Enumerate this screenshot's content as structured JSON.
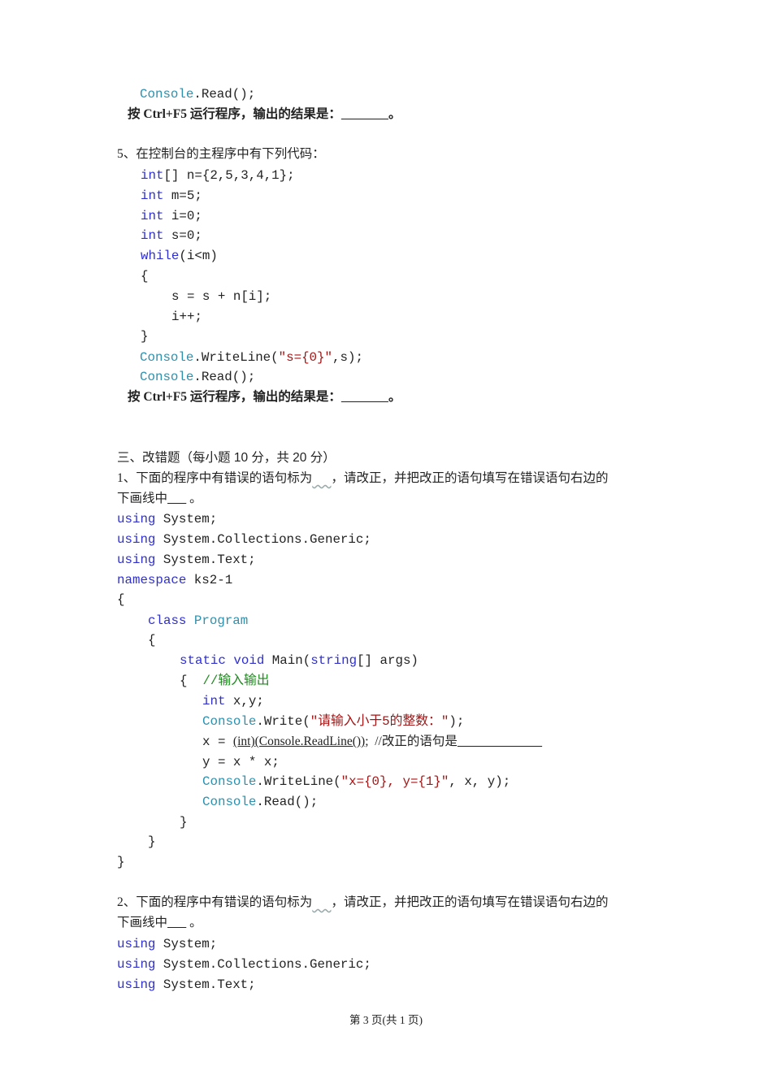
{
  "colors": {
    "keyword": "#2f2fd0",
    "type": "#2b91af",
    "string": "#a31515",
    "comment": "#1f8a1f"
  },
  "lines": [
    {
      "kind": "code",
      "segs": [
        [
          "Console",
          "type"
        ],
        [
          ".Read();",
          "plain"
        ]
      ]
    },
    {
      "kind": "bold",
      "segs": [
        [
          "按 Ctrl+F5 运行程序，输出的结果是：",
          "plain"
        ],
        [
          "               ",
          "blank"
        ],
        [
          "。",
          "plain"
        ]
      ]
    },
    {
      "kind": "text",
      "segs": [
        [
          "5、在控制台的主程序中有下列代码：",
          "plain"
        ]
      ]
    },
    {
      "kind": "code",
      "segs": [
        [
          "int",
          "kw"
        ],
        [
          "[] n={2,5,3,4,1};",
          "plain"
        ]
      ]
    },
    {
      "kind": "code",
      "segs": [
        [
          "int",
          "kw"
        ],
        [
          " m=5;",
          "plain"
        ]
      ]
    },
    {
      "kind": "code",
      "segs": [
        [
          "int",
          "kw"
        ],
        [
          " i=0;",
          "plain"
        ]
      ]
    },
    {
      "kind": "code",
      "segs": [
        [
          "int",
          "kw"
        ],
        [
          " s=0;",
          "plain"
        ]
      ]
    },
    {
      "kind": "code",
      "segs": [
        [
          "while",
          "kw"
        ],
        [
          "(i<m)",
          "plain"
        ]
      ]
    },
    {
      "kind": "code",
      "segs": [
        [
          "{",
          "plain"
        ]
      ]
    },
    {
      "kind": "code",
      "segs": [
        [
          "s = s + n[i];",
          "plain"
        ]
      ]
    },
    {
      "kind": "code",
      "segs": [
        [
          "i++;",
          "plain"
        ]
      ]
    },
    {
      "kind": "code",
      "segs": [
        [
          "}",
          "plain"
        ]
      ]
    },
    {
      "kind": "code",
      "segs": [
        [
          "Console",
          "type"
        ],
        [
          ".WriteLine(",
          "plain"
        ],
        [
          "\"s={0}\"",
          "str"
        ],
        [
          ",s);",
          "plain"
        ]
      ]
    },
    {
      "kind": "code",
      "segs": [
        [
          "Console",
          "type"
        ],
        [
          ".Read();",
          "plain"
        ]
      ]
    },
    {
      "kind": "bold",
      "segs": [
        [
          "按 Ctrl+F5 运行程序，输出的结果是：",
          "plain"
        ],
        [
          "               ",
          "blank"
        ],
        [
          "。",
          "plain"
        ]
      ]
    },
    {
      "kind": "text",
      "segs": [
        [
          "三、改错题（",
          "plain"
        ],
        [
          "每小题 10 分，共 20 分",
          "sans"
        ],
        [
          "）",
          "plain"
        ]
      ]
    },
    {
      "kind": "text",
      "segs": [
        [
          "1、下面的程序中有错误的语句标为",
          "plain"
        ],
        [
          "      ",
          "wavy"
        ],
        [
          "，请改正，并把改正的语句填写在错误语句右边的",
          "plain"
        ]
      ]
    },
    {
      "kind": "text",
      "segs": [
        [
          "下画线中",
          "plain"
        ],
        [
          "      ",
          "blank"
        ],
        [
          " 。",
          "plain"
        ]
      ]
    },
    {
      "kind": "code",
      "segs": [
        [
          "using",
          "kw"
        ],
        [
          " System;",
          "plain"
        ]
      ]
    },
    {
      "kind": "code",
      "segs": [
        [
          "using",
          "kw"
        ],
        [
          " System.Collections.Generic;",
          "plain"
        ]
      ]
    },
    {
      "kind": "code",
      "segs": [
        [
          "using",
          "kw"
        ],
        [
          " System.Text;",
          "plain"
        ]
      ]
    },
    {
      "kind": "code",
      "segs": [
        [
          "namespace",
          "kw"
        ],
        [
          " ks2-1",
          "plain"
        ]
      ]
    },
    {
      "kind": "code",
      "segs": [
        [
          "{",
          "plain"
        ]
      ]
    },
    {
      "kind": "code",
      "segs": [
        [
          "class",
          "kw"
        ],
        [
          " ",
          "plain"
        ],
        [
          "Program",
          "type"
        ]
      ]
    },
    {
      "kind": "code",
      "segs": [
        [
          "{",
          "plain"
        ]
      ]
    },
    {
      "kind": "code",
      "segs": [
        [
          "static",
          "kw"
        ],
        [
          " ",
          "plain"
        ],
        [
          "void",
          "kw"
        ],
        [
          " Main(",
          "plain"
        ],
        [
          "string",
          "kw"
        ],
        [
          "[] args)",
          "plain"
        ]
      ]
    },
    {
      "kind": "code",
      "segs": [
        [
          "{  ",
          "plain"
        ],
        [
          "//输入输出",
          "cmt"
        ]
      ]
    },
    {
      "kind": "code",
      "segs": [
        [
          "int",
          "kw"
        ],
        [
          " x,y;",
          "plain"
        ]
      ]
    },
    {
      "kind": "code",
      "segs": [
        [
          "Console",
          "type"
        ],
        [
          ".Write(",
          "plain"
        ],
        [
          "\"请输入小于5的整数：\"",
          "str"
        ],
        [
          ");",
          "plain"
        ]
      ]
    },
    {
      "kind": "code",
      "segs": [
        [
          "x = ",
          "plain"
        ],
        [
          "(int)(Console.ReadLine())",
          "ul"
        ],
        [
          ";  //改正的语句是",
          "plain"
        ],
        [
          "           ",
          "blank"
        ]
      ]
    },
    {
      "kind": "code",
      "segs": [
        [
          "y = x * x;",
          "plain"
        ]
      ]
    },
    {
      "kind": "code",
      "segs": [
        [
          "Console",
          "type"
        ],
        [
          ".WriteLine(",
          "plain"
        ],
        [
          "\"x={0}, y={1}\"",
          "str"
        ],
        [
          ", x, y);",
          "plain"
        ]
      ]
    },
    {
      "kind": "code",
      "segs": [
        [
          "Console",
          "type"
        ],
        [
          ".Read();",
          "plain"
        ]
      ]
    },
    {
      "kind": "code",
      "segs": [
        [
          "}",
          "plain"
        ]
      ]
    },
    {
      "kind": "code",
      "segs": [
        [
          "}",
          "plain"
        ]
      ]
    },
    {
      "kind": "code",
      "segs": [
        [
          "}",
          "plain"
        ]
      ]
    },
    {
      "kind": "text",
      "segs": [
        [
          "2、下面的程序中有错误的语句标为",
          "plain"
        ],
        [
          "      ",
          "wavy"
        ],
        [
          "，请改正，并把改正的语句填写在错误语句右边的",
          "plain"
        ]
      ]
    },
    {
      "kind": "text",
      "segs": [
        [
          "下画线中",
          "plain"
        ],
        [
          "      ",
          "blank"
        ],
        [
          " 。",
          "plain"
        ]
      ]
    },
    {
      "kind": "code",
      "segs": [
        [
          "using",
          "kw"
        ],
        [
          " System;",
          "plain"
        ]
      ]
    },
    {
      "kind": "code",
      "segs": [
        [
          "using",
          "kw"
        ],
        [
          " System.Collections.Generic;",
          "plain"
        ]
      ]
    },
    {
      "kind": "code",
      "segs": [
        [
          "using",
          "kw"
        ],
        [
          " System.Text;",
          "plain"
        ]
      ]
    }
  ],
  "footer": "第 3 页(共 1 页)"
}
